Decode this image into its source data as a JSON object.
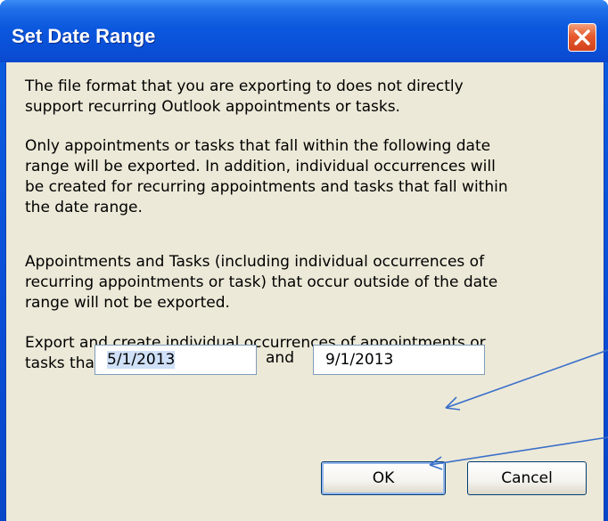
{
  "dialog": {
    "title": "Set Date Range",
    "paragraphs": [
      "The file format that you are exporting to does not directly\nsupport recurring Outlook appointments or tasks.",
      "Only appointments or tasks that fall within the following date\nrange will be exported.  In addition, individual occurrences will\nbe created for recurring appointments and tasks that fall within\nthe date range.",
      "Appointments and Tasks (including individual occurrences of\nrecurring appointments or task) that occur outside of the date\nrange will not be exported.",
      "Export and create individual occurrences of appointments or\ntasks that occur between:"
    ],
    "start_date": "5/1/2013",
    "and_label": "and",
    "end_date": "9/1/2013",
    "ok_label": "OK",
    "cancel_label": "Cancel"
  },
  "icons": {
    "close": "close-icon",
    "annotation": "arrow-icon"
  },
  "colors": {
    "titlebar": "#0a50d8",
    "dialog_background": "#ece9d8",
    "close_button": "#e0532a",
    "annotation_arrow": "#3a6fc9"
  }
}
